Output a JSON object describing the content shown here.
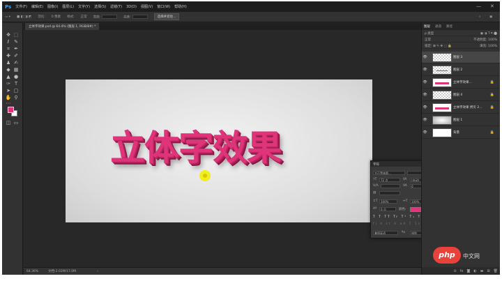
{
  "app": {
    "logo": "Ps"
  },
  "menu": [
    "文件(F)",
    "编辑(E)",
    "图像(I)",
    "图层(L)",
    "文字(Y)",
    "选择(S)",
    "滤镜(T)",
    "3D(D)",
    "视图(V)",
    "窗口(W)",
    "帮助(H)"
  ],
  "window_controls": {
    "minimize": "—",
    "close": "✕"
  },
  "options_bar": {
    "mode": "自动选择:",
    "sample": "图层",
    "feather_label": "羽化:",
    "feather_value": "0 像素",
    "style_label": "样式:",
    "style_value": "正常",
    "width_label": "宽度:",
    "height_label": "高度:",
    "select_button": "选择并遮住..."
  },
  "document_tab": {
    "title": "立体字效果.psd @ 64.4% (图层 1, RGB/8#) *"
  },
  "canvas": {
    "headline": "立体字效果",
    "text_color": "#e0347a"
  },
  "status_bar": {
    "zoom": "64.36%",
    "doc_info": "文档:2.02M/17.0M"
  },
  "character_panel": {
    "title": "字符",
    "font_family": "方正黑体简...",
    "font_size": "72 点",
    "leading": "(自动)",
    "kerning": "V/A",
    "tracking": "0",
    "vertical_scale": "100%",
    "horizontal_scale": "100%",
    "baseline": "0 点",
    "color_label": "颜色:",
    "color": "#e0357a",
    "language": "美国英语",
    "antialias": "锐利"
  },
  "layers_panel": {
    "tabs": [
      "图层",
      "通道",
      "路径"
    ],
    "filter_label": "ρ 类型",
    "blend_mode": "正常",
    "opacity_label": "不透明度:",
    "opacity": "100%",
    "lock_label": "锁定:",
    "fill_label": "填充:",
    "fill": "100%",
    "layers": [
      {
        "name": "图层 3",
        "thumb": "checker",
        "selected": true,
        "locked": false
      },
      {
        "name": "图层 2",
        "thumb": "strip",
        "selected": false,
        "locked": false
      },
      {
        "name": "立体字效果...",
        "thumb": "text",
        "selected": false,
        "locked": true
      },
      {
        "name": "图层 4",
        "thumb": "checker",
        "selected": false,
        "locked": true
      },
      {
        "name": "立体字效果 拷贝 2...",
        "thumb": "text",
        "selected": false,
        "locked": true
      },
      {
        "name": "图层 1",
        "thumb": "grad",
        "selected": false,
        "locked": false
      },
      {
        "name": "背景",
        "thumb": "white",
        "selected": false,
        "locked": true
      }
    ],
    "bottom_icons": [
      "link-icon",
      "fx-icon",
      "mask-icon",
      "adjustment-icon",
      "folder-icon",
      "new-layer-icon",
      "trash-icon"
    ]
  },
  "watermark": {
    "logo": "php",
    "text": "中文网"
  }
}
